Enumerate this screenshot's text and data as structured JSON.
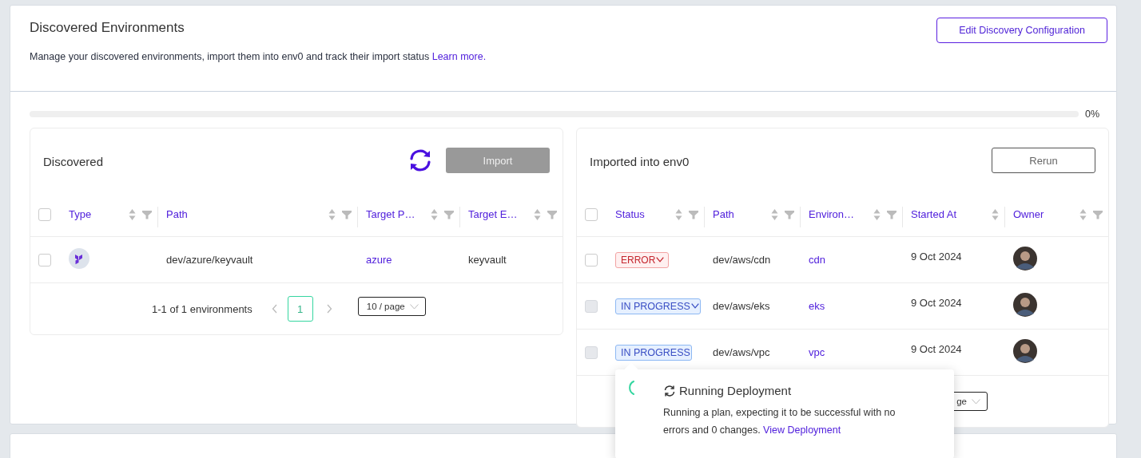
{
  "header": {
    "title": "Discovered Environments",
    "description": "Manage your discovered environments, import them into env0 and track their import status",
    "learn_more": "Learn more.",
    "edit_button": "Edit Discovery Configuration"
  },
  "progress": {
    "level": 0,
    "reading": "0%"
  },
  "discovered": {
    "title": "Discovered",
    "import_button": "Import",
    "import_disabled": true,
    "select_all_checked": false,
    "columns": [
      {
        "label": "Type",
        "sort": true,
        "filter": true
      },
      {
        "label": "Path",
        "sort": true,
        "filter": true
      },
      {
        "label": "Target P…",
        "sort": true,
        "filter": true
      },
      {
        "label": "Target E…",
        "sort": true,
        "filter": true
      }
    ],
    "rows": [
      {
        "checked": false,
        "path": "dev/azure/keyvault",
        "target_project": "azure",
        "target_environment": "keyvault"
      }
    ],
    "pagination": {
      "summary": "1-1 of 1 environments",
      "pages": [
        {
          "label": "1",
          "selected": true
        }
      ],
      "page_size": "10 / page"
    }
  },
  "imported": {
    "title": "Imported into env0",
    "rerun_button": "Rerun",
    "select_all_checked": false,
    "columns": [
      {
        "label": "Status",
        "sort": true,
        "filter": true
      },
      {
        "label": "Path",
        "sort": true,
        "filter": true
      },
      {
        "label": "Environ…",
        "sort": true,
        "filter": true
      },
      {
        "label": "Started At",
        "sort": true,
        "filter": false
      },
      {
        "label": "Owner",
        "sort": true,
        "filter": true
      }
    ],
    "rows": [
      {
        "checked": false,
        "disabled": false,
        "status": {
          "kind": "error",
          "label": "ERROR",
          "dropdown": true
        },
        "path": "dev/aws/cdn",
        "environment": "cdn",
        "started_at": "9 Oct 2024"
      },
      {
        "checked": false,
        "disabled": true,
        "status": {
          "kind": "in_progress",
          "label": "IN PROGRESS",
          "dropdown": true
        },
        "path": "dev/aws/eks",
        "environment": "eks",
        "started_at": "9 Oct 2024"
      },
      {
        "checked": false,
        "disabled": true,
        "status": {
          "kind": "in_progress",
          "label": "IN PROGRESS",
          "dropdown": false
        },
        "path": "dev/aws/vpc",
        "environment": "vpc",
        "started_at": "9 Oct 2024"
      }
    ],
    "pagination": {
      "page_size": "ge"
    }
  },
  "popover": {
    "title": "Running Deployment",
    "text": "Running a plan, expecting it to be successful with no errors and 0 changes.",
    "link": "View Deployment"
  }
}
